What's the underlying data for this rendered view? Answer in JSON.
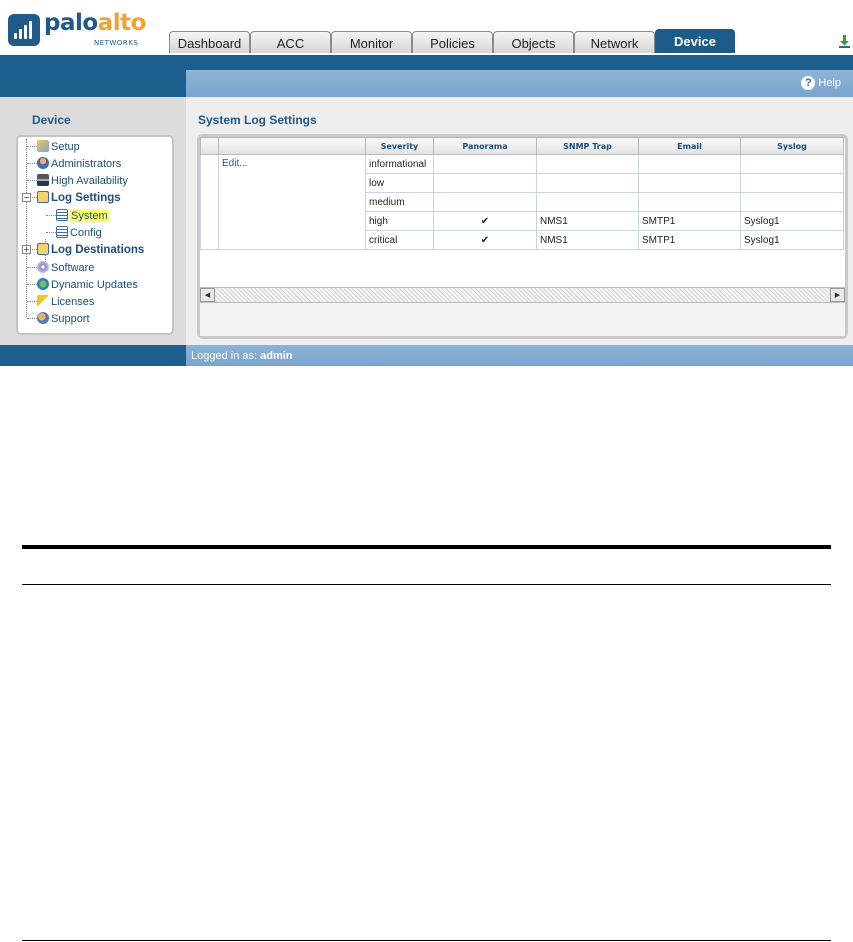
{
  "brand": {
    "name_part1": "palo",
    "name_part2": "alto",
    "subtitle": "NETWORKS"
  },
  "tabs": [
    {
      "label": "Dashboard"
    },
    {
      "label": "ACC"
    },
    {
      "label": "Monitor"
    },
    {
      "label": "Policies"
    },
    {
      "label": "Objects"
    },
    {
      "label": "Network"
    },
    {
      "label": "Device",
      "active": true
    }
  ],
  "help": {
    "label": "Help"
  },
  "sidebar": {
    "title": "Device",
    "items": [
      {
        "label": "Setup",
        "icon": "wrench-icon"
      },
      {
        "label": "Administrators",
        "icon": "user-icon"
      },
      {
        "label": "High Availability",
        "icon": "server-icon"
      },
      {
        "label": "Log Settings",
        "icon": "log-folder-icon",
        "expanded": true
      },
      {
        "label": "System",
        "icon": "document-icon",
        "selected": true
      },
      {
        "label": "Config",
        "icon": "document-icon"
      },
      {
        "label": "Log Destinations",
        "icon": "log-folder-icon",
        "expanded": false
      },
      {
        "label": "Software",
        "icon": "disk-icon"
      },
      {
        "label": "Dynamic Updates",
        "icon": "globe-icon"
      },
      {
        "label": "Licenses",
        "icon": "key-icon"
      },
      {
        "label": "Support",
        "icon": "support-icon"
      }
    ]
  },
  "main": {
    "title": "System Log Settings",
    "table": {
      "columns": [
        "",
        "Severity",
        "Panorama",
        "SNMP Trap",
        "Email",
        "Syslog"
      ],
      "edit_label": "Edit...",
      "rows": [
        {
          "severity": "informational",
          "panorama": "",
          "snmp": "",
          "email": "",
          "syslog": ""
        },
        {
          "severity": "low",
          "panorama": "",
          "snmp": "",
          "email": "",
          "syslog": ""
        },
        {
          "severity": "medium",
          "panorama": "",
          "snmp": "",
          "email": "",
          "syslog": ""
        },
        {
          "severity": "high",
          "panorama": "✔",
          "snmp": "NMS1",
          "email": "SMTP1",
          "syslog": "Syslog1"
        },
        {
          "severity": "critical",
          "panorama": "✔",
          "snmp": "NMS1",
          "email": "SMTP1",
          "syslog": "Syslog1"
        }
      ]
    }
  },
  "status": {
    "prefix": "Logged in as:",
    "user": "admin"
  }
}
